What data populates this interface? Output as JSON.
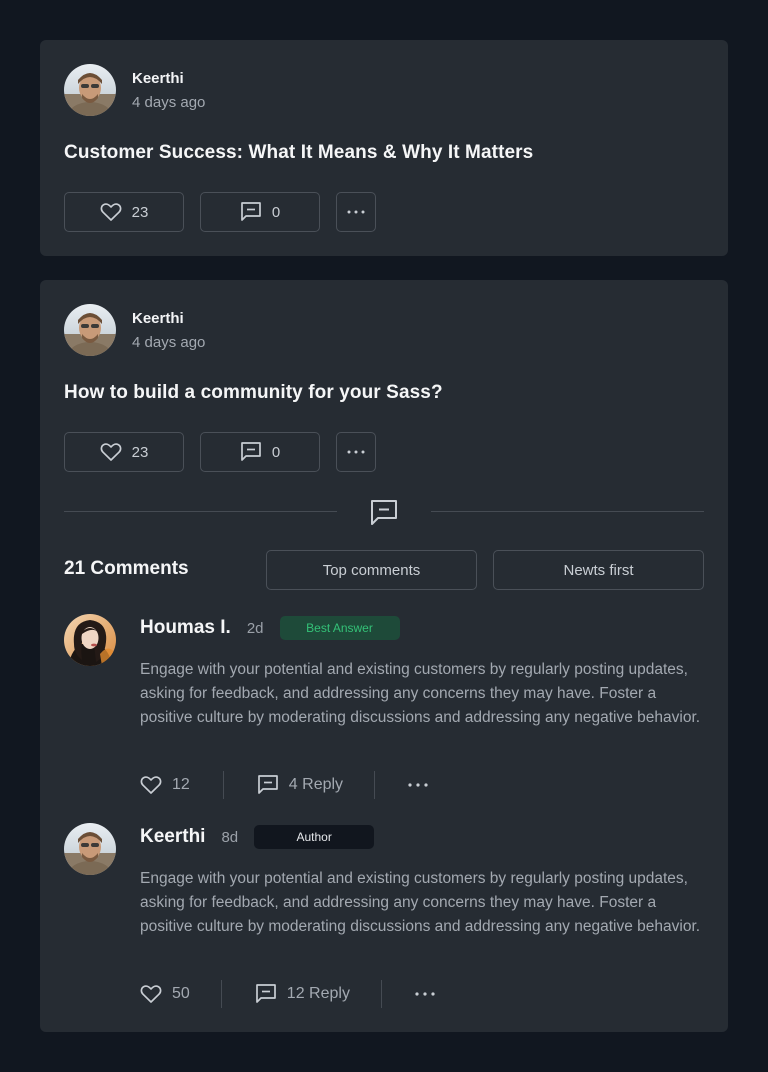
{
  "posts": [
    {
      "author": "Keerthi",
      "time": "4 days ago",
      "title": "Customer Success: What It Means & Why It Matters",
      "likes": "23",
      "comments": "0"
    },
    {
      "author": "Keerthi",
      "time": "4 days ago",
      "title": "How to build a community for your Sass?",
      "likes": "23",
      "comments": "0"
    }
  ],
  "comments_section": {
    "count_label": "21 Comments",
    "sort_top": "Top comments",
    "sort_newest": "Newts first",
    "items": [
      {
        "name": "Houmas I.",
        "time": "2d",
        "badge": "Best Answer",
        "body": "Engage with your potential and existing customers by regularly posting updates, asking for feedback, and addressing any concerns they may have. Foster a positive culture by moderating discussions and addressing any negative behavior.",
        "likes": "12",
        "replies": "4 Reply"
      },
      {
        "name": "Keerthi",
        "time": "8d",
        "badge": "Author",
        "body": "Engage with your potential and existing customers by regularly posting updates, asking for feedback, and addressing any concerns they may have. Foster a positive culture by moderating discussions and addressing any negative behavior.",
        "likes": "50",
        "replies": "12 Reply"
      }
    ]
  },
  "icons": {
    "like": "heart-icon",
    "comment": "comment-icon",
    "more": "more-dots-icon",
    "divider": "comment-icon"
  },
  "colors": {
    "background": "#111720",
    "card": "#262c33",
    "best_answer_bg": "#1e4a39",
    "best_answer_text": "#34c177",
    "author_badge_bg": "#11161e"
  }
}
